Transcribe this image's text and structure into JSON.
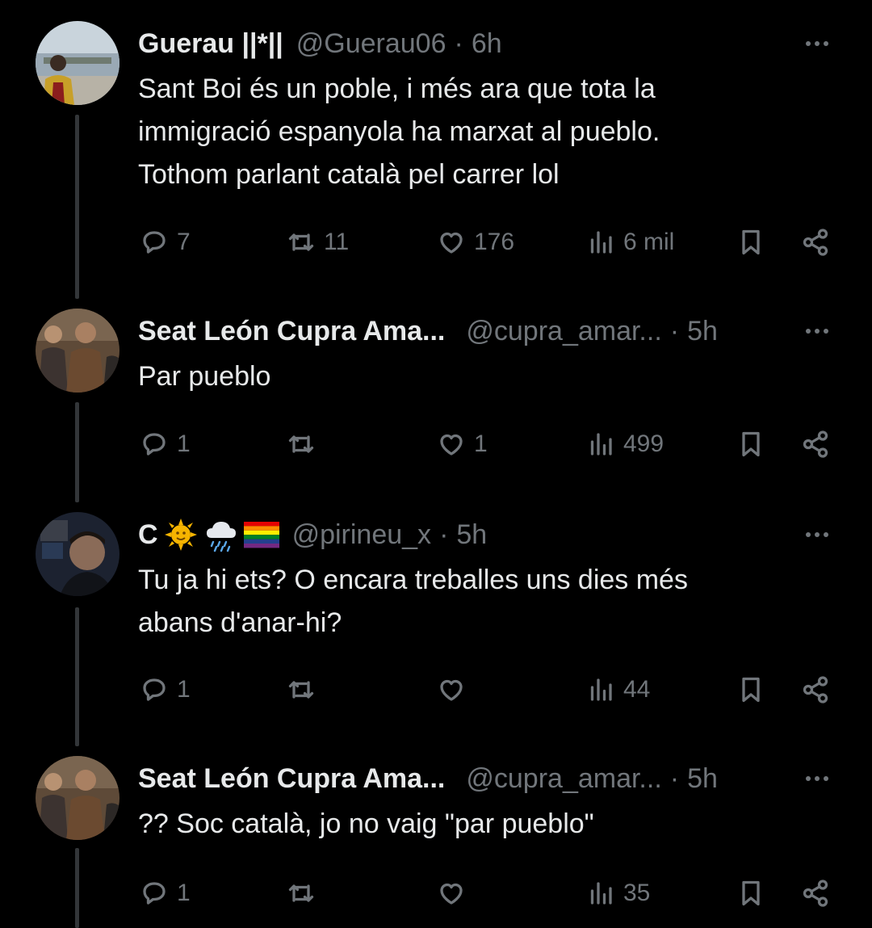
{
  "tweets": [
    {
      "name": "Guerau ||*||",
      "handle": "@Guerau06",
      "time": "6h",
      "text": "Sant Boi és un poble, i més ara que tota la\nimmigració espanyola ha marxat al pueblo.\nTothom parlant català pel carrer lol",
      "replies": "7",
      "reposts": "11",
      "likes": "176",
      "views": "6 mil"
    },
    {
      "name": "Seat León Cupra Ama...",
      "handle": "@cupra_amar...",
      "time": "5h",
      "text": "Par pueblo",
      "replies": "1",
      "reposts": "",
      "likes": "1",
      "views": "499"
    },
    {
      "name": "C",
      "handle": "@pirineu_x",
      "time": "5h",
      "name_emojis": [
        "sun-with-face-icon",
        "cloud-with-rain-icon",
        "rainbow-flag-icon"
      ],
      "text": "Tu ja hi ets? O encara treballes uns dies més\nabans d'anar-hi?",
      "replies": "1",
      "reposts": "",
      "likes": "",
      "views": "44"
    },
    {
      "name": "Seat León Cupra Ama...",
      "handle": "@cupra_amar...",
      "time": "5h",
      "text": "?? Soc català, jo no vaig \"par pueblo\"",
      "replies": "1",
      "reposts": "",
      "likes": "",
      "views": "35"
    }
  ],
  "separator": "·",
  "colors": {
    "background": "#000000",
    "text_primary": "#e7e9ea",
    "text_secondary": "#71767b",
    "thread_line": "#333639"
  }
}
